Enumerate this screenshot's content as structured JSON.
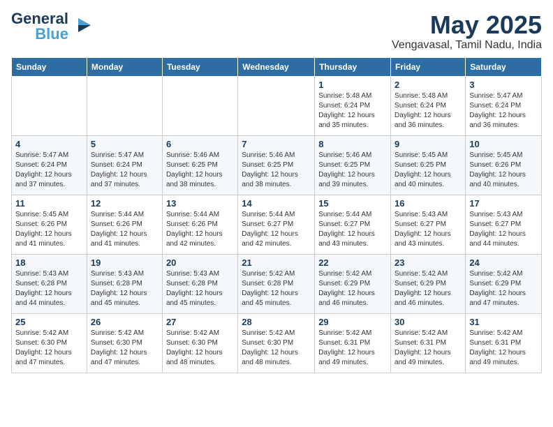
{
  "logo": {
    "line1": "General",
    "line2": "Blue"
  },
  "title": "May 2025",
  "location": "Vengavasal, Tamil Nadu, India",
  "days_of_week": [
    "Sunday",
    "Monday",
    "Tuesday",
    "Wednesday",
    "Thursday",
    "Friday",
    "Saturday"
  ],
  "weeks": [
    [
      {
        "day": "",
        "info": ""
      },
      {
        "day": "",
        "info": ""
      },
      {
        "day": "",
        "info": ""
      },
      {
        "day": "",
        "info": ""
      },
      {
        "day": "1",
        "info": "Sunrise: 5:48 AM\nSunset: 6:24 PM\nDaylight: 12 hours\nand 35 minutes."
      },
      {
        "day": "2",
        "info": "Sunrise: 5:48 AM\nSunset: 6:24 PM\nDaylight: 12 hours\nand 36 minutes."
      },
      {
        "day": "3",
        "info": "Sunrise: 5:47 AM\nSunset: 6:24 PM\nDaylight: 12 hours\nand 36 minutes."
      }
    ],
    [
      {
        "day": "4",
        "info": "Sunrise: 5:47 AM\nSunset: 6:24 PM\nDaylight: 12 hours\nand 37 minutes."
      },
      {
        "day": "5",
        "info": "Sunrise: 5:47 AM\nSunset: 6:24 PM\nDaylight: 12 hours\nand 37 minutes."
      },
      {
        "day": "6",
        "info": "Sunrise: 5:46 AM\nSunset: 6:25 PM\nDaylight: 12 hours\nand 38 minutes."
      },
      {
        "day": "7",
        "info": "Sunrise: 5:46 AM\nSunset: 6:25 PM\nDaylight: 12 hours\nand 38 minutes."
      },
      {
        "day": "8",
        "info": "Sunrise: 5:46 AM\nSunset: 6:25 PM\nDaylight: 12 hours\nand 39 minutes."
      },
      {
        "day": "9",
        "info": "Sunrise: 5:45 AM\nSunset: 6:25 PM\nDaylight: 12 hours\nand 40 minutes."
      },
      {
        "day": "10",
        "info": "Sunrise: 5:45 AM\nSunset: 6:26 PM\nDaylight: 12 hours\nand 40 minutes."
      }
    ],
    [
      {
        "day": "11",
        "info": "Sunrise: 5:45 AM\nSunset: 6:26 PM\nDaylight: 12 hours\nand 41 minutes."
      },
      {
        "day": "12",
        "info": "Sunrise: 5:44 AM\nSunset: 6:26 PM\nDaylight: 12 hours\nand 41 minutes."
      },
      {
        "day": "13",
        "info": "Sunrise: 5:44 AM\nSunset: 6:26 PM\nDaylight: 12 hours\nand 42 minutes."
      },
      {
        "day": "14",
        "info": "Sunrise: 5:44 AM\nSunset: 6:27 PM\nDaylight: 12 hours\nand 42 minutes."
      },
      {
        "day": "15",
        "info": "Sunrise: 5:44 AM\nSunset: 6:27 PM\nDaylight: 12 hours\nand 43 minutes."
      },
      {
        "day": "16",
        "info": "Sunrise: 5:43 AM\nSunset: 6:27 PM\nDaylight: 12 hours\nand 43 minutes."
      },
      {
        "day": "17",
        "info": "Sunrise: 5:43 AM\nSunset: 6:27 PM\nDaylight: 12 hours\nand 44 minutes."
      }
    ],
    [
      {
        "day": "18",
        "info": "Sunrise: 5:43 AM\nSunset: 6:28 PM\nDaylight: 12 hours\nand 44 minutes."
      },
      {
        "day": "19",
        "info": "Sunrise: 5:43 AM\nSunset: 6:28 PM\nDaylight: 12 hours\nand 45 minutes."
      },
      {
        "day": "20",
        "info": "Sunrise: 5:43 AM\nSunset: 6:28 PM\nDaylight: 12 hours\nand 45 minutes."
      },
      {
        "day": "21",
        "info": "Sunrise: 5:42 AM\nSunset: 6:28 PM\nDaylight: 12 hours\nand 45 minutes."
      },
      {
        "day": "22",
        "info": "Sunrise: 5:42 AM\nSunset: 6:29 PM\nDaylight: 12 hours\nand 46 minutes."
      },
      {
        "day": "23",
        "info": "Sunrise: 5:42 AM\nSunset: 6:29 PM\nDaylight: 12 hours\nand 46 minutes."
      },
      {
        "day": "24",
        "info": "Sunrise: 5:42 AM\nSunset: 6:29 PM\nDaylight: 12 hours\nand 47 minutes."
      }
    ],
    [
      {
        "day": "25",
        "info": "Sunrise: 5:42 AM\nSunset: 6:30 PM\nDaylight: 12 hours\nand 47 minutes."
      },
      {
        "day": "26",
        "info": "Sunrise: 5:42 AM\nSunset: 6:30 PM\nDaylight: 12 hours\nand 47 minutes."
      },
      {
        "day": "27",
        "info": "Sunrise: 5:42 AM\nSunset: 6:30 PM\nDaylight: 12 hours\nand 48 minutes."
      },
      {
        "day": "28",
        "info": "Sunrise: 5:42 AM\nSunset: 6:30 PM\nDaylight: 12 hours\nand 48 minutes."
      },
      {
        "day": "29",
        "info": "Sunrise: 5:42 AM\nSunset: 6:31 PM\nDaylight: 12 hours\nand 49 minutes."
      },
      {
        "day": "30",
        "info": "Sunrise: 5:42 AM\nSunset: 6:31 PM\nDaylight: 12 hours\nand 49 minutes."
      },
      {
        "day": "31",
        "info": "Sunrise: 5:42 AM\nSunset: 6:31 PM\nDaylight: 12 hours\nand 49 minutes."
      }
    ]
  ]
}
